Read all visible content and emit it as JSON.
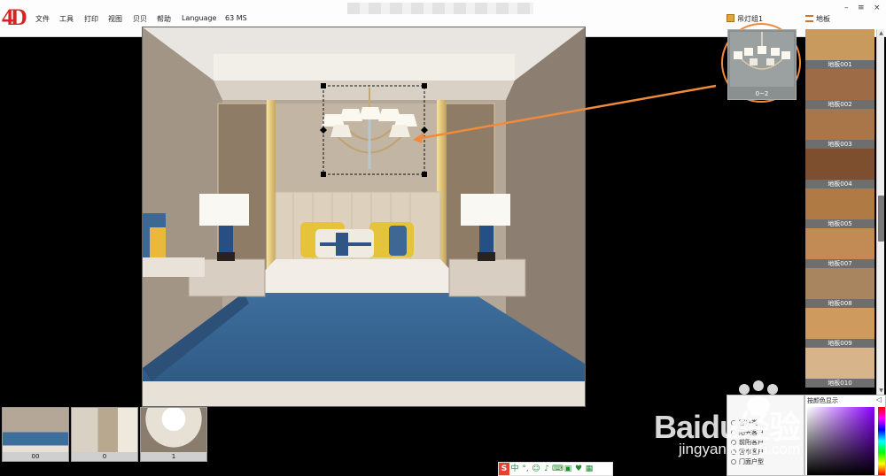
{
  "app": {
    "logo": "4D"
  },
  "menu": {
    "items": [
      "文件",
      "工具",
      "打印",
      "视图",
      "贝贝",
      "帮助",
      "Language",
      "63 MS"
    ]
  },
  "window_controls": {
    "minimize": "–",
    "maximize": "≡",
    "close": "×"
  },
  "panels": {
    "lamp_header": "吊灯组1",
    "floor_header": "地板",
    "lamp_thumb_label": "0~2"
  },
  "floors": [
    {
      "label": "地板001",
      "color": "#c89a5e"
    },
    {
      "label": "地板002",
      "color": "#9d6b45"
    },
    {
      "label": "地板003",
      "color": "#a9764a"
    },
    {
      "label": "地板004",
      "color": "#7d4f2e"
    },
    {
      "label": "地板005",
      "color": "#b07a44"
    },
    {
      "label": "地板007",
      "color": "#c28b56"
    },
    {
      "label": "地板008",
      "color": "#a8855f"
    },
    {
      "label": "地板009",
      "color": "#cf9a5e"
    },
    {
      "label": "地板010",
      "color": "#d8b48a"
    }
  ],
  "scenes": [
    {
      "label": "00"
    },
    {
      "label": "0"
    },
    {
      "label": "1"
    }
  ],
  "tree": {
    "rows": [
      "客户类",
      "阳光客户",
      "前阳客户",
      "雷市客户",
      "门面户型"
    ]
  },
  "color_panel": {
    "title": "按颜色显示",
    "collapse": "◁"
  },
  "watermark": {
    "text": "Baidu经验",
    "url": "jingyan.baidu.com"
  },
  "ime": {
    "items": [
      "S",
      "中",
      "°,",
      "☺",
      "♪",
      "⌨",
      "▣",
      "♥",
      "▦"
    ]
  }
}
